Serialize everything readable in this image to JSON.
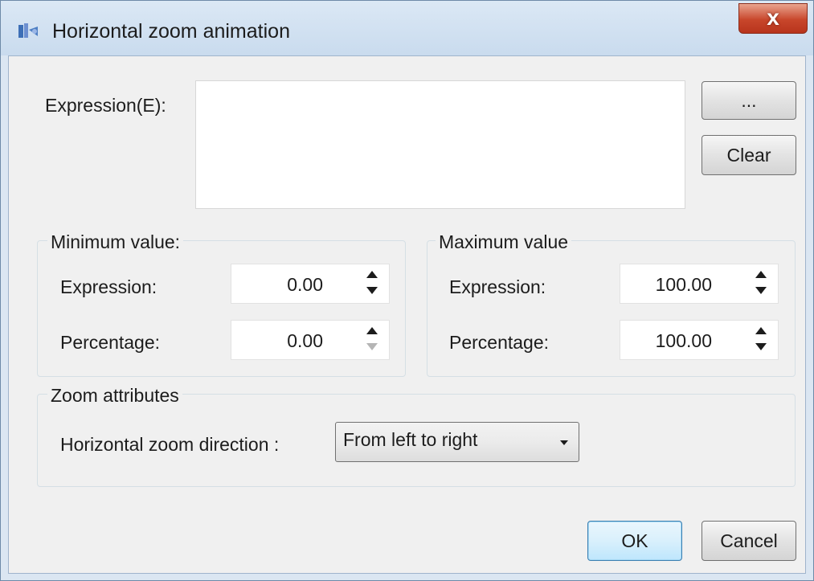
{
  "window": {
    "title": "Horizontal zoom animation",
    "icon": "app-icon",
    "close_label": "x"
  },
  "expression": {
    "label": "Expression(E):",
    "value": "",
    "browse_label": "...",
    "clear_label": "Clear"
  },
  "minimum": {
    "group_title": "Minimum value:",
    "expression_label": "Expression:",
    "expression_value": "0.00",
    "percentage_label": "Percentage:",
    "percentage_value": "0.00"
  },
  "maximum": {
    "group_title": "Maximum value",
    "expression_label": "Expression:",
    "expression_value": "100.00",
    "percentage_label": "Percentage:",
    "percentage_value": "100.00"
  },
  "zoom": {
    "group_title": "Zoom attributes",
    "direction_label": "Horizontal zoom direction :",
    "direction_value": "From left to right"
  },
  "footer": {
    "ok_label": "OK",
    "cancel_label": "Cancel"
  }
}
